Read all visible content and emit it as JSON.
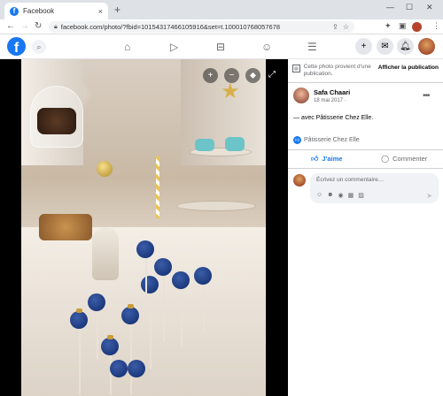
{
  "browser": {
    "tab_title": "Facebook",
    "tab_favicon": "f",
    "tab_close": "×",
    "new_tab": "+",
    "url": "facebook.com/photo/?fbid=10154317466105916&set=t.100010768057678",
    "window_controls": [
      "—",
      "☐",
      "✕"
    ]
  },
  "fb": {
    "logo": "f",
    "nav_icons": [
      "home-icon",
      "watch-icon",
      "marketplace-icon",
      "groups-icon",
      "menu-icon"
    ]
  },
  "viewer": {
    "zoom_in": "+",
    "zoom_out": "−",
    "tag": "⬥",
    "expand": "⤢"
  },
  "side": {
    "notice_text": "Cette photo provient d'une publication.",
    "notice_link": "Afficher la publication",
    "author_name": "Safa Chaari",
    "post_date": "18 mai 2017",
    "privacy": "·",
    "more": "•••",
    "caption": "— avec Pâtisserie Chez Elle.",
    "page_tag": "Pâtisserie Chez Elle",
    "like_label": "J'aime",
    "comment_label": "Commenter",
    "comment_placeholder": "Écrivez un commentaire…",
    "send": "➤"
  },
  "colors": {
    "facebook_blue": "#1877f2",
    "secondary_text": "#65676b"
  }
}
